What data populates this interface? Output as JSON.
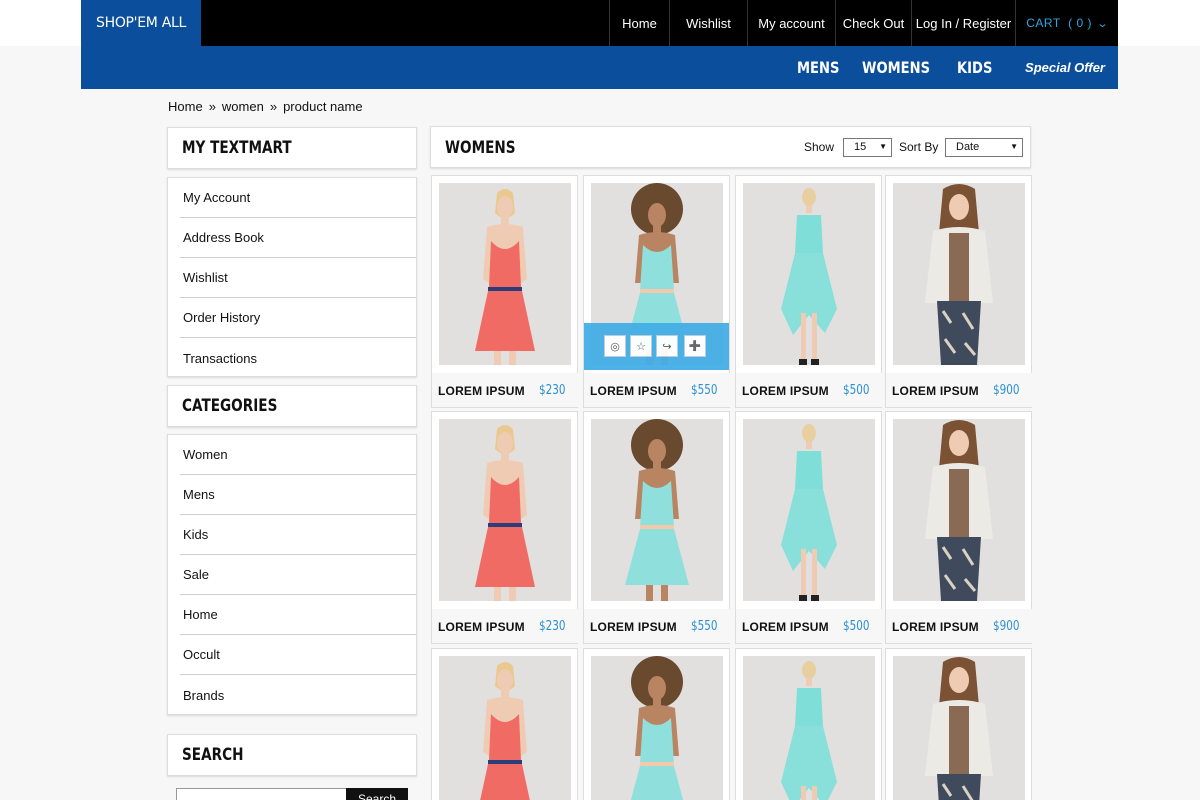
{
  "brand": {
    "logo_text": "SHOP'EM ALL",
    "accent": "#0b4e9c",
    "price_color": "#2b8fd3"
  },
  "topnav": {
    "items": [
      "Home",
      "Wishlist",
      "My account",
      "Check Out",
      "Log In / Register"
    ],
    "cart_label": "CART  ( 0 )"
  },
  "catnav": {
    "items": [
      "MENS",
      "WOMENS",
      "KIDS"
    ],
    "special": "Special Offer"
  },
  "breadcrumb": [
    "Home",
    "women",
    "product name"
  ],
  "sidebar": {
    "account_title": "MY TEXTMART",
    "account_items": [
      "My Account",
      "Address Book",
      "Wishlist",
      "Order History",
      "Transactions"
    ],
    "categories_title": "CATEGORIES",
    "categories_items": [
      "Women",
      "Mens",
      "Kids",
      "Sale",
      "Home",
      "Occult",
      "Brands"
    ],
    "search_title": "SEARCH",
    "search_button": "Search"
  },
  "main": {
    "title": "WOMENS",
    "show_label": "Show",
    "show_value": "15",
    "sort_label": "Sort By",
    "sort_value": "Date"
  },
  "products": [
    {
      "name": "LOREM IPSUM",
      "price": "$230",
      "model": "coral-dress"
    },
    {
      "name": "LOREM IPSUM",
      "price": "$550",
      "model": "aqua-dress-curly"
    },
    {
      "name": "LOREM IPSUM",
      "price": "$500",
      "model": "aqua-long-dress"
    },
    {
      "name": "LOREM IPSUM",
      "price": "$900",
      "model": "jacket-outfit"
    },
    {
      "name": "LOREM IPSUM",
      "price": "$230",
      "model": "coral-dress"
    },
    {
      "name": "LOREM IPSUM",
      "price": "$550",
      "model": "aqua-dress-curly"
    },
    {
      "name": "LOREM IPSUM",
      "price": "$500",
      "model": "aqua-long-dress"
    },
    {
      "name": "LOREM IPSUM",
      "price": "$900",
      "model": "jacket-outfit"
    },
    {
      "name": "",
      "price": "",
      "model": "coral-dress"
    },
    {
      "name": "",
      "price": "",
      "model": "aqua-dress-curly"
    },
    {
      "name": "",
      "price": "",
      "model": "aqua-long-dress"
    },
    {
      "name": "",
      "price": "",
      "model": "jacket-outfit"
    }
  ],
  "hover_actions": [
    "eye-icon",
    "star-icon",
    "share-icon",
    "cart-add-icon"
  ]
}
